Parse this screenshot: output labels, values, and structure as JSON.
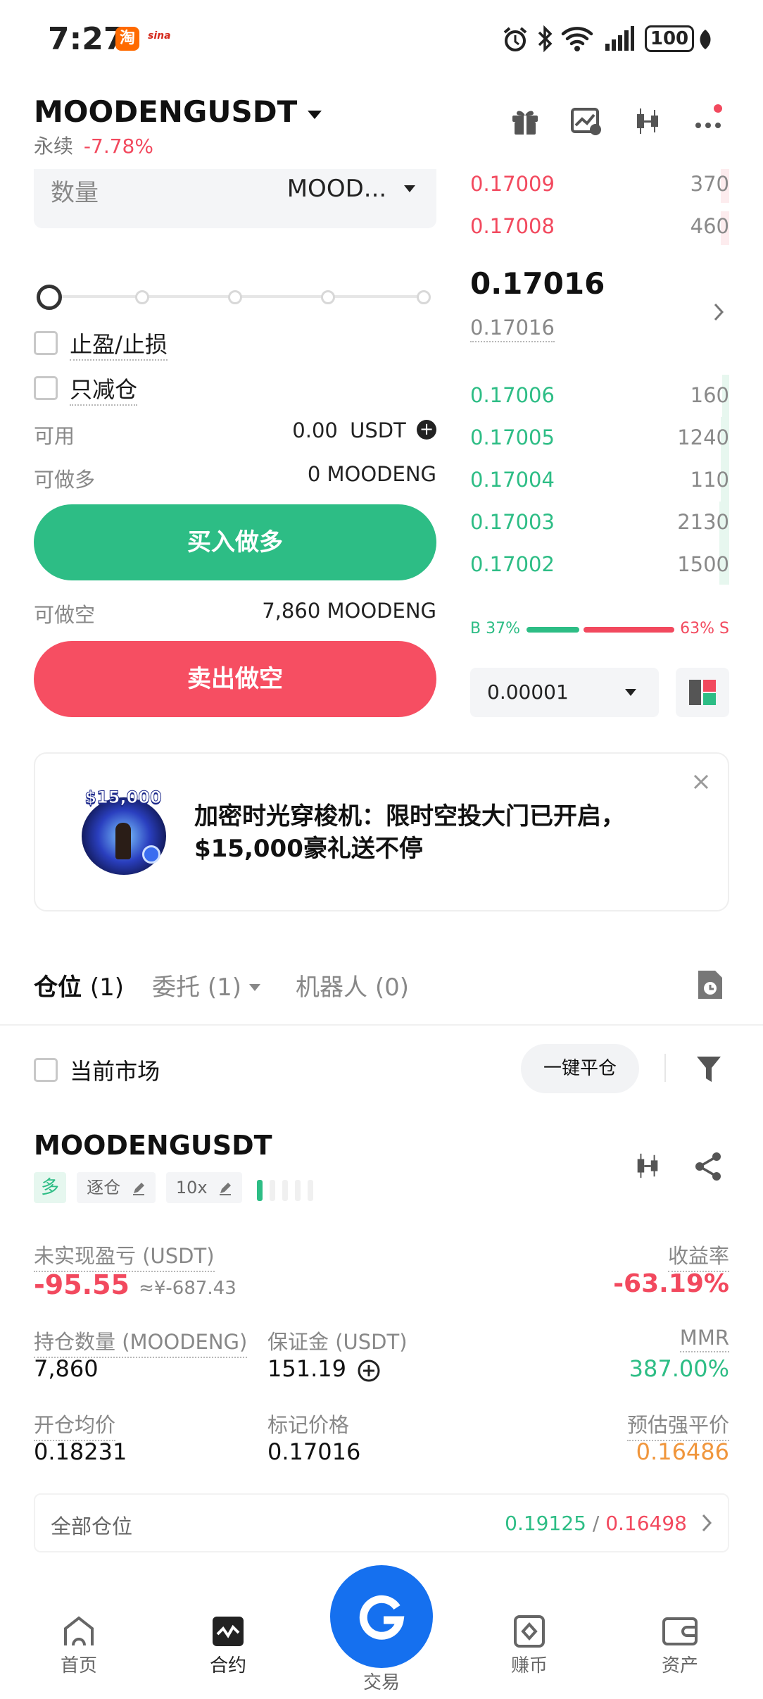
{
  "status_bar": {
    "time": "7:27",
    "app_icon_1": "taobao-icon",
    "app_icon_2": "sina-icon",
    "sina_label": "sina",
    "battery": "100"
  },
  "header": {
    "symbol": "MOODENGUSDT",
    "contract_type": "永续",
    "change_pct": "-7.78%"
  },
  "order_form": {
    "quantity_label": "数量",
    "unit_label": "MOOD...",
    "tp_sl_label": "止盈/止损",
    "reduce_only_label": "只减仓",
    "available_label": "可用",
    "available_value": "0.00",
    "available_unit": "USDT",
    "can_long_label": "可做多",
    "can_long_value": "0 MOODENG",
    "buy_button": "买入做多",
    "can_short_label": "可做空",
    "can_short_value": "7,860 MOODENG",
    "sell_button": "卖出做空",
    "slider_level": 0
  },
  "order_book": {
    "asks": [
      {
        "price": "0.17009",
        "qty": "370"
      },
      {
        "price": "0.17008",
        "qty": "460"
      }
    ],
    "last_price": "0.17016",
    "mark_price": "0.17016",
    "bids": [
      {
        "price": "0.17006",
        "qty": "160"
      },
      {
        "price": "0.17005",
        "qty": "1240"
      },
      {
        "price": "0.17004",
        "qty": "110"
      },
      {
        "price": "0.17003",
        "qty": "2130"
      },
      {
        "price": "0.17002",
        "qty": "1500"
      }
    ],
    "buy_ratio_label": "B",
    "buy_ratio": "37%",
    "sell_ratio": "63%",
    "sell_ratio_label": "S",
    "buy_fraction": 0.37,
    "precision": "0.00001"
  },
  "banner": {
    "image_text": "$15,000",
    "line1": "加密时光穿梭机：限时空投大门已开启，",
    "line2": "$15,000豪礼送不停"
  },
  "tabs": {
    "positions": "仓位",
    "positions_count": "(1)",
    "orders": "委托",
    "orders_count": "(1)",
    "bots": "机器人",
    "bots_count": "(0)"
  },
  "filter_row": {
    "current_market_label": "当前市场",
    "close_all_button": "一键平仓"
  },
  "position": {
    "symbol": "MOODENGUSDT",
    "side": "多",
    "margin_mode": "逐仓",
    "leverage": "10x",
    "unrealized_pnl_label": "未实现盈亏 (USDT)",
    "unrealized_pnl": "-95.55",
    "unrealized_pnl_cny": "≈¥-687.43",
    "roe_label": "收益率",
    "roe": "-63.19%",
    "size_label": "持仓数量 (MOODENG)",
    "size": "7,860",
    "margin_label": "保证金 (USDT)",
    "margin": "151.19",
    "mmr_label": "MMR",
    "mmr": "387.00%",
    "entry_label": "开仓均价",
    "entry_price": "0.18231",
    "mark_label": "标记价格",
    "mark_price": "0.17016",
    "liq_label": "预估强平价",
    "liq_price": "0.16486",
    "all_positions_label": "全部仓位",
    "tp_price": "0.19125",
    "separator": "/",
    "sl_price": "0.16498"
  },
  "bottom_nav": {
    "home": "首页",
    "futures": "合约",
    "trade": "交易",
    "earn": "赚币",
    "assets": "资产"
  },
  "colors": {
    "green": "#2dbd85",
    "red": "#f2495e",
    "orange": "#f0963c",
    "blue": "#1570ef"
  }
}
